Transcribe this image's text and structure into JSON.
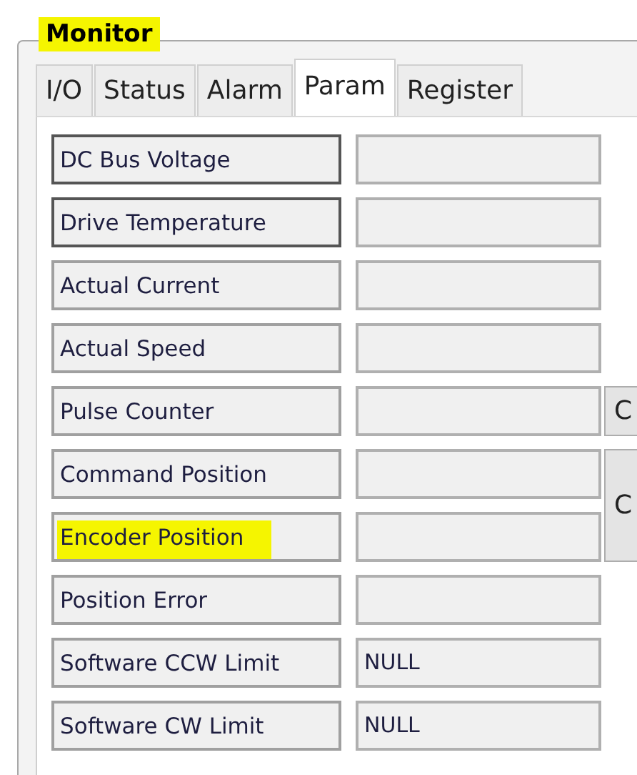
{
  "group": {
    "title": "Monitor",
    "highlighted": true
  },
  "tabs": [
    {
      "label": "I/O",
      "selected": false
    },
    {
      "label": "Status",
      "selected": false
    },
    {
      "label": "Alarm",
      "selected": false
    },
    {
      "label": "Param",
      "selected": true
    },
    {
      "label": "Register",
      "selected": false
    }
  ],
  "rows": [
    {
      "label": "DC Bus Voltage",
      "dark_border": true,
      "highlighted": false
    },
    {
      "label": "Drive Temperature",
      "dark_border": true,
      "highlighted": false
    },
    {
      "label": "Actual Current",
      "dark_border": false,
      "highlighted": false
    },
    {
      "label": "Actual Speed",
      "dark_border": false,
      "highlighted": false
    },
    {
      "label": "Pulse Counter",
      "dark_border": false,
      "highlighted": false
    },
    {
      "label": "Command Position",
      "dark_border": false,
      "highlighted": false
    },
    {
      "label": "Encoder Position",
      "dark_border": false,
      "highlighted": true
    },
    {
      "label": "Position Error",
      "dark_border": false,
      "highlighted": false
    },
    {
      "label": "Software CCW Limit",
      "dark_border": false,
      "highlighted": false,
      "value": "NULL"
    },
    {
      "label": "Software CW Limit",
      "dark_border": false,
      "highlighted": false,
      "value": "NULL"
    }
  ],
  "side_buttons": [
    {
      "label": "C"
    },
    {
      "label": "C"
    }
  ]
}
